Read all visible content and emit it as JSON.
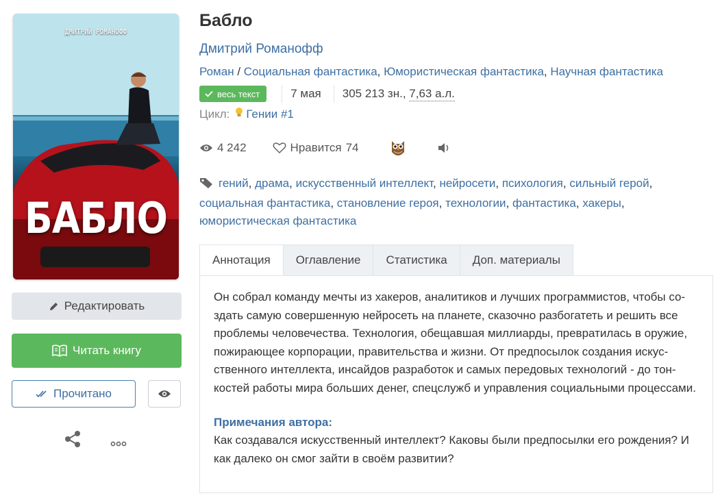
{
  "book": {
    "title": "Бабло",
    "author": "Дмитрий Романофф",
    "genre_prefix": "Роман",
    "genres": [
      "Социальная фантастика",
      "Юмористическая фантастика",
      "Научная фантастика"
    ],
    "badge": "весь текст",
    "date": "7 мая",
    "size_chars": "305 213 зн., ",
    "size_sheets": "7,63 а.л.",
    "cycle_label": "Цикл:",
    "cycle_name": "Гении #1"
  },
  "cover": {
    "author_text": "ДМИТРИЙ РОМАНОФФ",
    "title_text": "БАБЛО"
  },
  "stats": {
    "views": "4 242",
    "likes_label": "Нравится",
    "likes": "74"
  },
  "tags": [
    "гений",
    "драма",
    "искусственный интеллект",
    "нейросети",
    "психология",
    "сильный герой",
    "социальная фантастика",
    "становление героя",
    "технологии",
    "фантастика",
    "хакеры",
    "юмористическая фантастика"
  ],
  "buttons": {
    "edit": "Редактировать",
    "read": "Читать книгу",
    "done": "Прочитано"
  },
  "tabs": [
    "Аннотация",
    "Оглавление",
    "Статистика",
    "Доп. материалы"
  ],
  "annotation": "Он собрал команду мечты из хакеров, аналитиков и лучших программистов, чтобы со­здать самую совершенную нейросеть на планете, сказочно разбогатеть и решить все проблемы человечества. Технология, обещавшая миллиарды, превратилась в оружие, пожирающее корпорации, правительства и жизни. От предпосылок создания искус­ственного интеллекта, инсайдов разработок и самых передовых технологий - до тон­костей работы мира больших денег, спецслужб и управления социальными процессами.",
  "notes": {
    "title": "Примечания автора:",
    "text": "Как создавался искусственный интеллект? Каковы были предпосылки его рождения? И как далеко он смог зайти в своём развитии?"
  },
  "colors": {
    "link": "#3d6fa3",
    "green": "#5cb85c"
  },
  "icons": [
    "pencil-icon",
    "book-icon",
    "double-check-icon",
    "eye-icon",
    "share-icon",
    "more-icon",
    "check-icon",
    "bulb-icon",
    "heart-icon",
    "owl-icon",
    "speaker-icon",
    "tag-icon"
  ]
}
